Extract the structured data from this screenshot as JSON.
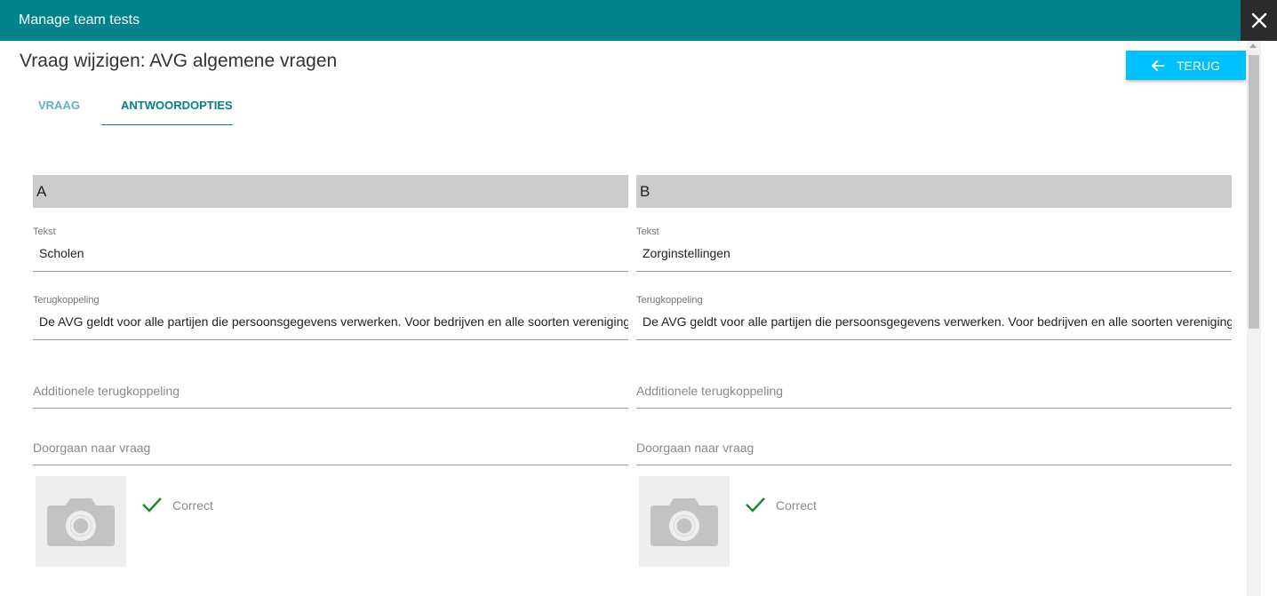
{
  "window": {
    "title": "Manage team tests",
    "close_icon": "close-icon"
  },
  "page": {
    "title": "Vraag wijzigen: AVG algemene vragen",
    "back_button": "TERUG"
  },
  "tabs": [
    {
      "label": "VRAAG",
      "active": false
    },
    {
      "label": "ANTWOORDOPTIES",
      "active": true
    }
  ],
  "colors": {
    "header": "#00838a",
    "accent_button": "#00bfff",
    "check": "#1b8a2a"
  },
  "answers": [
    {
      "letter": "A",
      "tekst_label": "Tekst",
      "tekst_value": "Scholen",
      "feedback_label": "Terugkoppeling",
      "feedback_value": "De AVG geldt voor alle partijen die persoonsgegevens verwerken. Voor bedrijven en alle soorten verenigingen en",
      "additional_placeholder": "Additionele terugkoppeling",
      "goto_placeholder": "Doorgaan naar vraag",
      "correct_label": "Correct"
    },
    {
      "letter": "B",
      "tekst_label": "Tekst",
      "tekst_value": "Zorginstellingen",
      "feedback_label": "Terugkoppeling",
      "feedback_value": "De AVG geldt voor alle partijen die persoonsgegevens verwerken. Voor bedrijven en alle soorten verenigingen en",
      "additional_placeholder": "Additionele terugkoppeling",
      "goto_placeholder": "Doorgaan naar vraag",
      "correct_label": "Correct"
    }
  ]
}
